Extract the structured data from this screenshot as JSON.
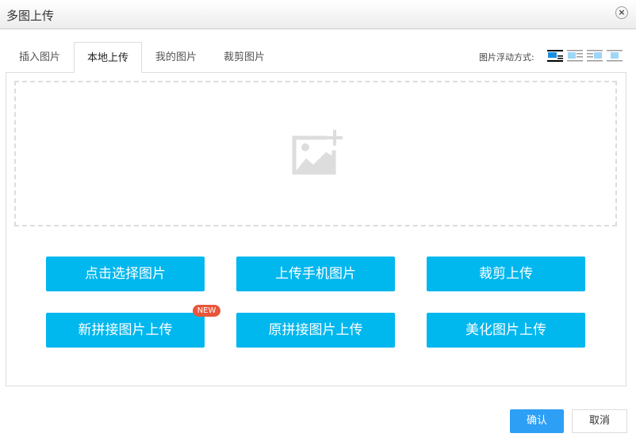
{
  "dialog": {
    "title": "多图上传",
    "close_icon": "close-circle-icon"
  },
  "tabs": [
    {
      "label": "插入图片",
      "active": false
    },
    {
      "label": "本地上传",
      "active": true
    },
    {
      "label": "我的图片",
      "active": false
    },
    {
      "label": "裁剪图片",
      "active": false
    }
  ],
  "float": {
    "label": "图片浮动方式:",
    "options": [
      "none",
      "left",
      "right",
      "center"
    ],
    "selected": "none"
  },
  "dropzone": {
    "icon": "add-image-icon"
  },
  "buttons": [
    {
      "label": "点击选择图片"
    },
    {
      "label": "上传手机图片"
    },
    {
      "label": "裁剪上传"
    },
    {
      "label": "新拼接图片上传",
      "badge": "NEW"
    },
    {
      "label": "原拼接图片上传"
    },
    {
      "label": "美化图片上传"
    }
  ],
  "footer": {
    "confirm": "确认",
    "cancel": "取消"
  },
  "colors": {
    "primary": "#00b7ee",
    "confirm": "#2d9ff5",
    "badge": "#e8563b"
  }
}
